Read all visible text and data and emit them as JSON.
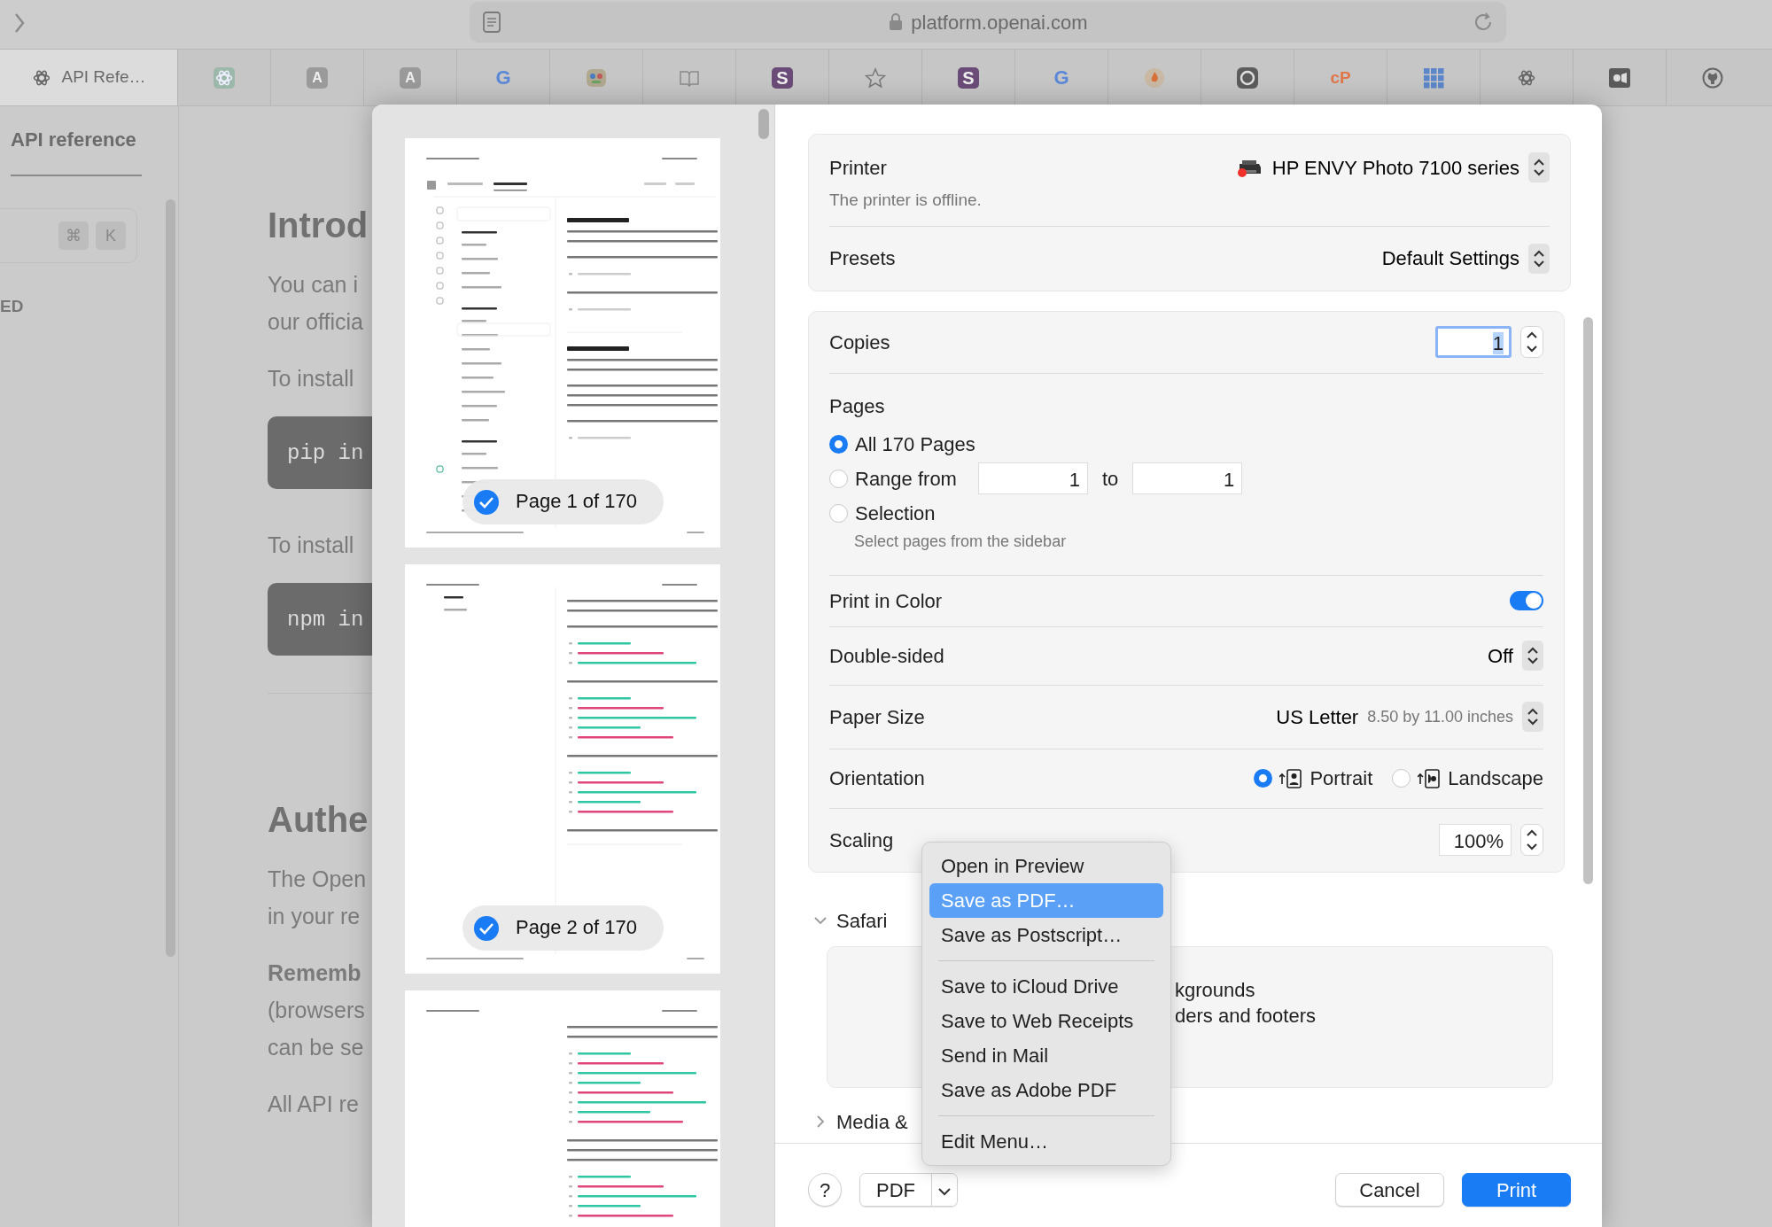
{
  "browser": {
    "address": "platform.openai.com",
    "tabs": [
      {
        "kind": "knot",
        "label": "API Refe…",
        "selected": true
      },
      {
        "kind": "knot-tile",
        "selected": false
      },
      {
        "kind": "gray-tile",
        "glyph": "A",
        "selected": false
      },
      {
        "kind": "gray-tile",
        "glyph": "A",
        "selected": false
      },
      {
        "kind": "google",
        "glyph": "G",
        "selected": false
      },
      {
        "kind": "badge",
        "selected": false
      },
      {
        "kind": "book",
        "selected": false
      },
      {
        "kind": "purple-tile",
        "glyph": "S",
        "selected": false
      },
      {
        "kind": "star",
        "selected": false
      },
      {
        "kind": "purple-tile",
        "glyph": "S",
        "selected": false
      },
      {
        "kind": "google",
        "glyph": "G",
        "selected": false
      },
      {
        "kind": "flame",
        "selected": false
      },
      {
        "kind": "ring",
        "selected": false
      },
      {
        "kind": "orange-text",
        "glyph": "cP",
        "selected": false
      },
      {
        "kind": "grid",
        "selected": false
      },
      {
        "kind": "knot",
        "selected": false
      },
      {
        "kind": "camera",
        "selected": false
      },
      {
        "kind": "github",
        "selected": false
      }
    ]
  },
  "page": {
    "nav_tab": "API reference",
    "shortcut": [
      "⌘",
      "K"
    ],
    "sidebar_heading": "ED",
    "content": [
      {
        "kind": "heading",
        "text": "Introd"
      },
      {
        "kind": "paragraph",
        "lines": [
          "You can i",
          "our officia"
        ]
      },
      {
        "kind": "paragraph",
        "lines": [
          "To install"
        ]
      },
      {
        "kind": "code",
        "text": "pip in"
      },
      {
        "kind": "paragraph",
        "lines": [
          "To install"
        ]
      },
      {
        "kind": "code",
        "text": "npm in"
      },
      {
        "kind": "rule"
      },
      {
        "kind": "heading",
        "text": "Authe"
      },
      {
        "kind": "paragraph",
        "lines": [
          "The Open",
          "in your re"
        ]
      },
      {
        "kind": "paragraph",
        "lines": [
          "**Rememb**",
          "(browsers",
          "can be se"
        ]
      },
      {
        "kind": "paragraph",
        "lines": [
          "All API re"
        ]
      }
    ]
  },
  "print_dialog": {
    "previews": [
      {
        "kind": "nav-page",
        "badge": "Page 1 of 170",
        "selected": true
      },
      {
        "kind": "sidebar-page",
        "badge": "Page 2 of 170",
        "selected": true
      },
      {
        "kind": "article-page"
      }
    ],
    "printer": {
      "label": "Printer",
      "value": "HP ENVY Photo 7100 series",
      "status": "The printer is offline.",
      "offline": true
    },
    "presets": {
      "label": "Presets",
      "value": "Default Settings"
    },
    "copies": {
      "label": "Copies",
      "value": "1"
    },
    "pages": {
      "label": "Pages",
      "options": [
        {
          "kind": "all",
          "label": "All 170 Pages",
          "selected": true
        },
        {
          "kind": "range",
          "label": "Range from",
          "from": "1",
          "to_label": "to",
          "to": "1",
          "selected": false
        },
        {
          "kind": "selection",
          "label": "Selection",
          "hint": "Select pages from the sidebar",
          "selected": false
        }
      ]
    },
    "print_in_color": {
      "label": "Print in Color",
      "on": true
    },
    "double_sided": {
      "label": "Double-sided",
      "value": "Off"
    },
    "paper_size": {
      "label": "Paper Size",
      "value": "US Letter",
      "detail": "8.50 by 11.00 inches"
    },
    "orientation": {
      "label": "Orientation",
      "options": [
        {
          "kind": "portrait",
          "label": "Portrait",
          "selected": true
        },
        {
          "kind": "landscape",
          "label": "Landscape",
          "selected": false
        }
      ]
    },
    "scaling": {
      "label": "Scaling",
      "value": "100%"
    },
    "sections": [
      {
        "label": "Safari",
        "expanded": true,
        "items": [
          "kgrounds",
          "ders and footers"
        ]
      },
      {
        "label": "Media &",
        "expanded": false
      }
    ],
    "help": "?",
    "pdf_button": "PDF",
    "cancel": "Cancel",
    "print": "Print",
    "pdf_menu": [
      {
        "kind": "item",
        "label": "Open in Preview",
        "selected": false
      },
      {
        "kind": "item",
        "label": "Save as PDF…",
        "selected": true
      },
      {
        "kind": "item",
        "label": "Save as Postscript…",
        "selected": false
      },
      {
        "kind": "separator"
      },
      {
        "kind": "item",
        "label": "Save to iCloud Drive",
        "selected": false
      },
      {
        "kind": "item",
        "label": "Save to Web Receipts",
        "selected": false
      },
      {
        "kind": "item",
        "label": "Send in Mail",
        "selected": false
      },
      {
        "kind": "item",
        "label": "Save as Adobe PDF",
        "selected": false
      },
      {
        "kind": "separator"
      },
      {
        "kind": "item",
        "label": "Edit Menu…",
        "selected": false
      }
    ]
  }
}
